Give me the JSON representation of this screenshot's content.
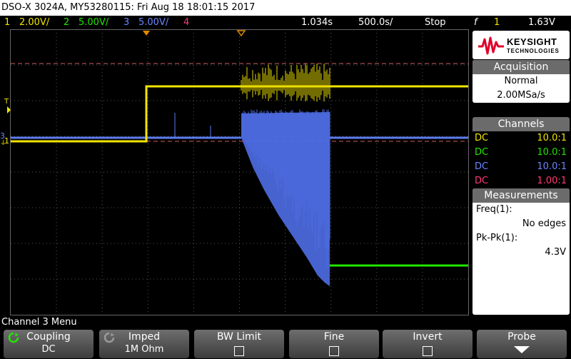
{
  "title_bar": {
    "text": "DSO-X 3024A, MY53280115: Fri Aug 18 18:01:15 2017"
  },
  "status_bar": {
    "ch1": {
      "num": "1",
      "scale": "2.00V/",
      "color": "#f2e600"
    },
    "ch2": {
      "num": "2",
      "scale": "5.00V/",
      "color": "#22e600"
    },
    "ch3": {
      "num": "3",
      "scale": "5.00V/",
      "color": "#6a86ff"
    },
    "ch4": {
      "num": "4",
      "color": "#ff3877"
    },
    "delay": "1.034s",
    "timebase": "500.0s/",
    "run_state": "Stop",
    "trigger_symbol": "f",
    "trigger_source": "1",
    "trigger_level": "1.63V"
  },
  "brand": {
    "name": "KEYSIGHT",
    "sub": "TECHNOLOGIES",
    "accent": "#e0002a"
  },
  "acquisition": {
    "header": "Acquisition",
    "mode": "Normal",
    "rate": "2.00MSa/s"
  },
  "channels": {
    "header": "Channels",
    "rows": [
      {
        "coupling": "DC",
        "probe": "10.0:1",
        "color": "#f2e600"
      },
      {
        "coupling": "DC",
        "probe": "10.0:1",
        "color": "#22e600"
      },
      {
        "coupling": "DC",
        "probe": "10.0:1",
        "color": "#6a86ff"
      },
      {
        "coupling": "DC",
        "probe": "1.00:1",
        "color": "#ff3877"
      }
    ]
  },
  "measurements": {
    "header": "Measurements",
    "freq_label": "Freq(1):",
    "freq_value": "No edges",
    "pkpk_label": "Pk-Pk(1):",
    "pkpk_value": "4.3V"
  },
  "menu": {
    "title": "Channel 3 Menu",
    "keys": [
      {
        "label": "Coupling",
        "value": "DC"
      },
      {
        "label": "Imped",
        "value": "1M Ohm"
      },
      {
        "label": "BW Limit"
      },
      {
        "label": "Fine"
      },
      {
        "label": "Invert"
      },
      {
        "label": "Probe"
      }
    ]
  },
  "markers": {
    "trigger_t": "T",
    "ch1_ref": "1",
    "ch3_ref": "3"
  }
}
